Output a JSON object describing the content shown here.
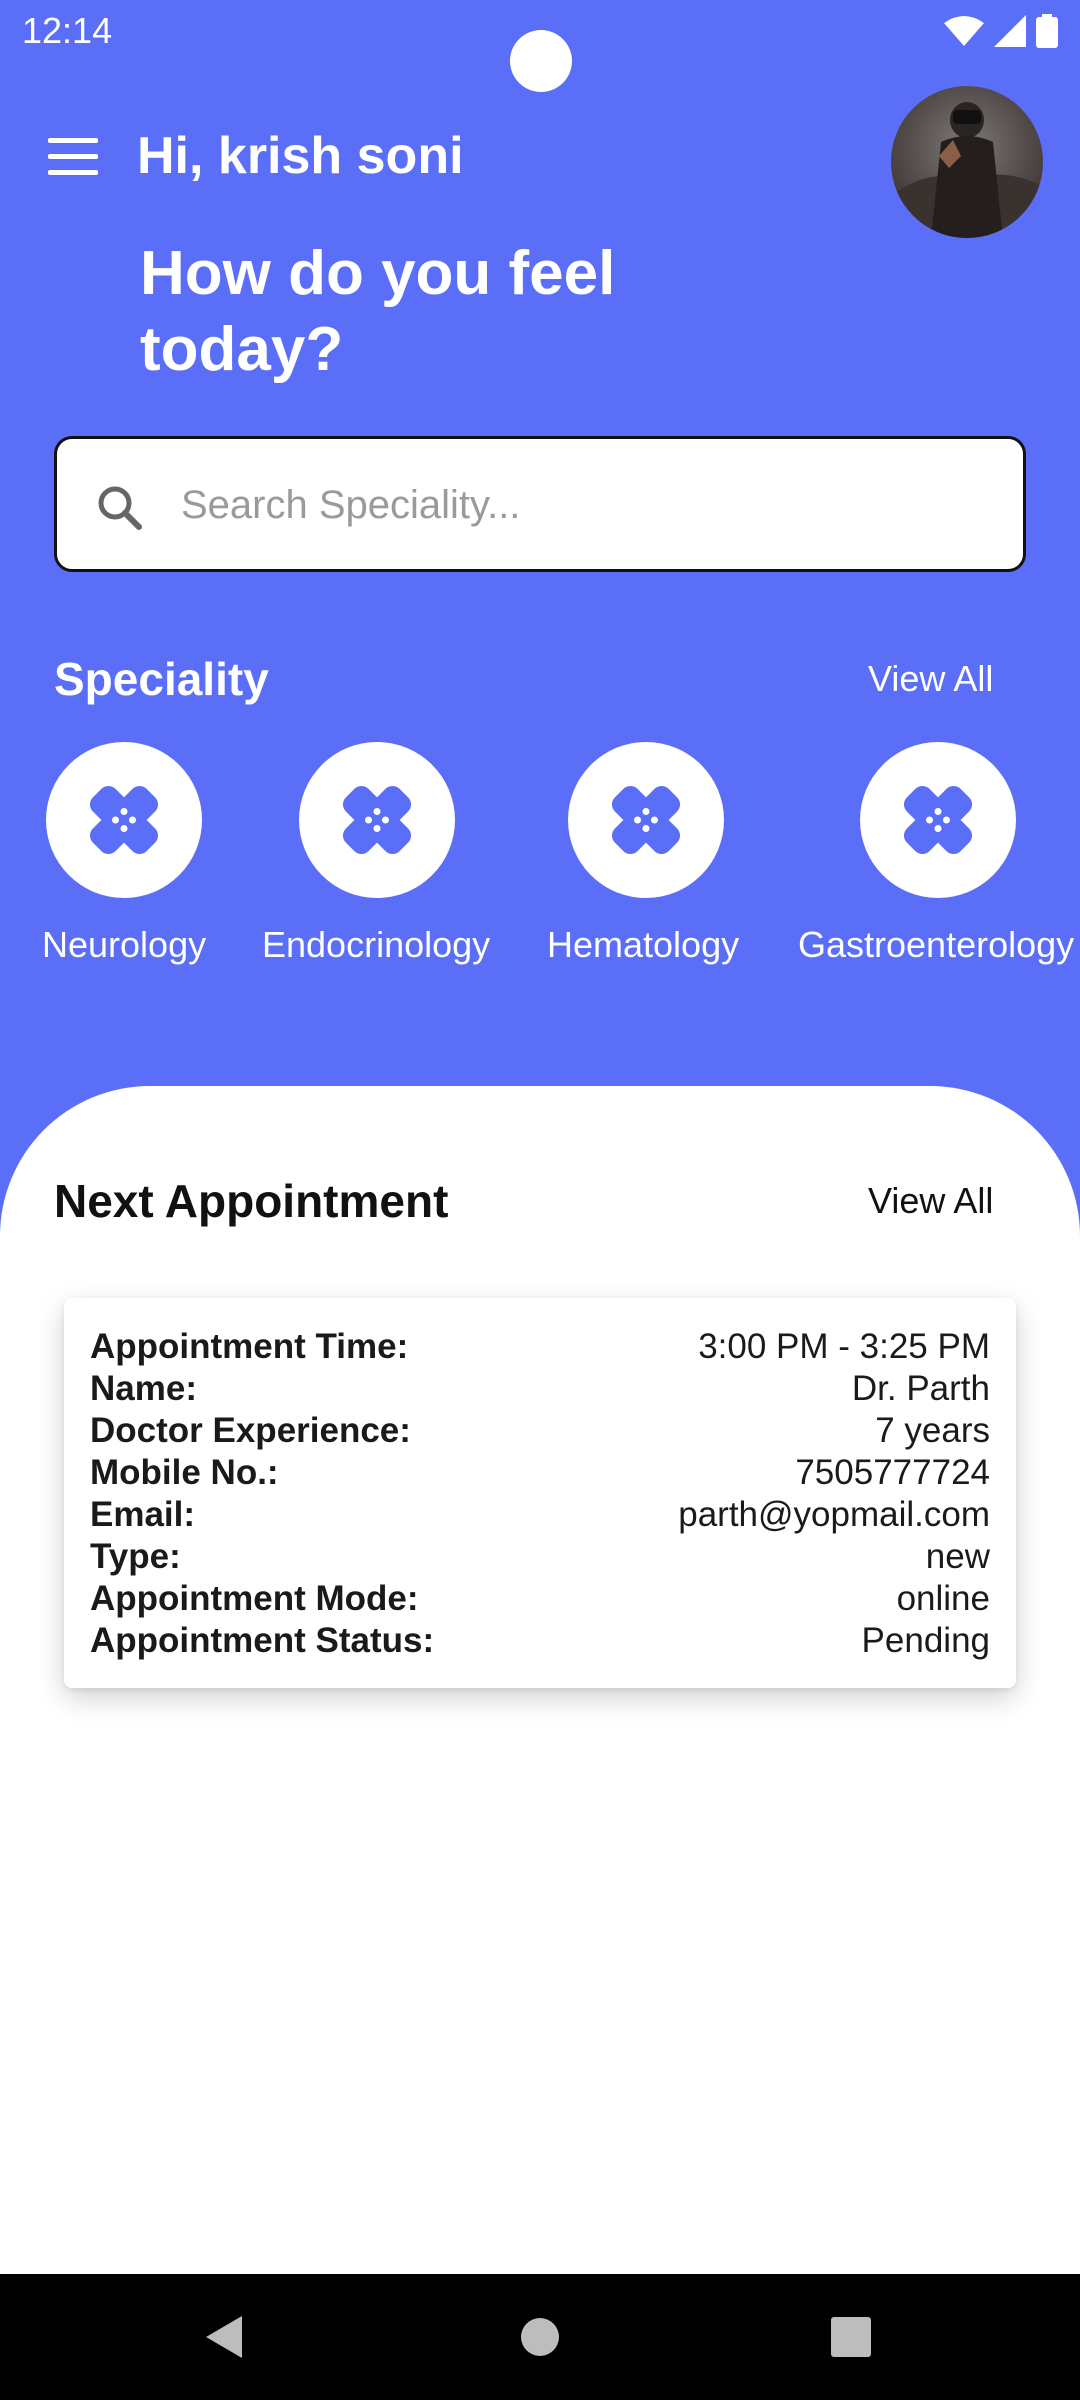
{
  "status_bar": {
    "time": "12:14"
  },
  "header": {
    "greeting": "Hi, krish soni"
  },
  "headline": "How do you feel today?",
  "search": {
    "placeholder": "Search Speciality..."
  },
  "speciality": {
    "title": "Speciality",
    "view_all": "View All",
    "items": [
      {
        "label": "Neurology"
      },
      {
        "label": "Endocrinology"
      },
      {
        "label": "Hematology"
      },
      {
        "label": "Gastroenterology"
      }
    ]
  },
  "appointment": {
    "title": "Next Appointment",
    "view_all": "View All",
    "rows": [
      {
        "key": "Appointment Time:",
        "value": "3:00 PM - 3:25 PM"
      },
      {
        "key": "Name:",
        "value": "Dr. Parth"
      },
      {
        "key": "Doctor Experience:",
        "value": "7 years"
      },
      {
        "key": "Mobile No.:",
        "value": "7505777724"
      },
      {
        "key": "Email:",
        "value": "parth@yopmail.com"
      },
      {
        "key": "Type:",
        "value": "new"
      },
      {
        "key": "Appointment Mode:",
        "value": "online"
      },
      {
        "key": "Appointment Status:",
        "value": "Pending"
      }
    ]
  },
  "colors": {
    "primary": "#5a6ef7",
    "icon": "#5a6ef7"
  }
}
